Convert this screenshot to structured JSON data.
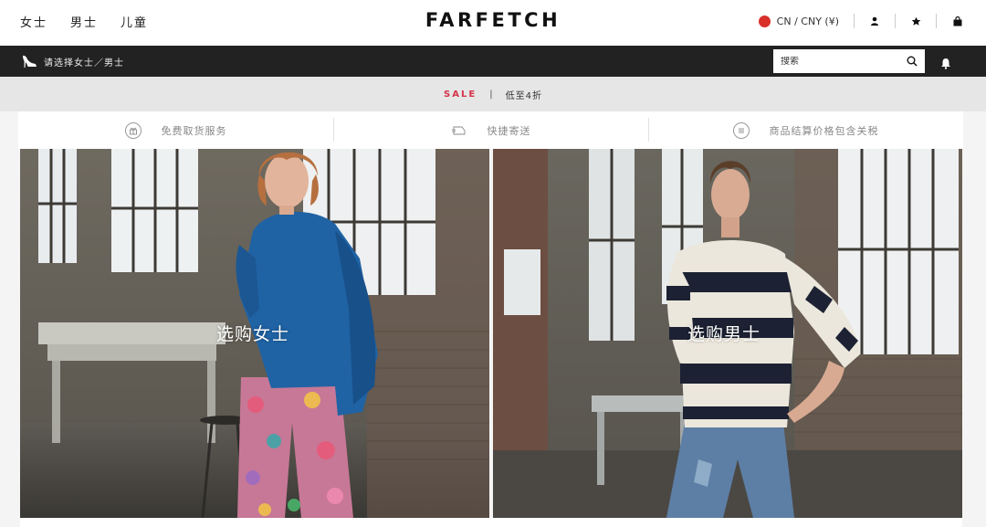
{
  "header": {
    "nav": [
      {
        "label": "女士"
      },
      {
        "label": "男士"
      },
      {
        "label": "儿童"
      }
    ],
    "logo": "FARFETCH",
    "currency": "CN / CNY (¥)",
    "icons": [
      "user-icon",
      "star-icon",
      "bag-icon"
    ]
  },
  "subbar": {
    "gender_prompt": "请选择女士／男士",
    "search_placeholder": "搜索"
  },
  "sale_banner": {
    "sale_label": "SALE",
    "separator": "|",
    "text": "低至4折"
  },
  "services": [
    {
      "label": "免费取货服务",
      "icon": "gift-icon"
    },
    {
      "label": "快捷寄送",
      "icon": "delivery-icon"
    },
    {
      "label": "商品结算价格包含关税",
      "icon": "receipt-icon"
    }
  ],
  "hero": {
    "women_label": "选购女士",
    "men_label": "选购男士"
  },
  "colors": {
    "sale_red": "#d4344a",
    "subbar_black": "#222222",
    "flag_red": "#d9302a"
  }
}
